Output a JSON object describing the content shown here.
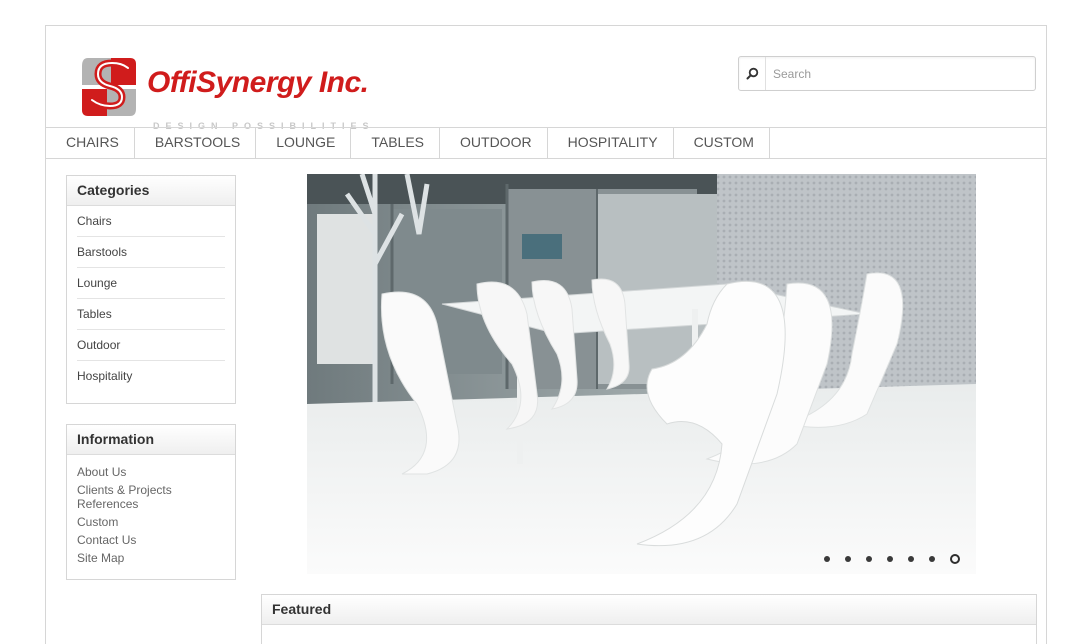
{
  "header": {
    "logo_name": "OffiSynergy Inc.",
    "logo_tagline": "DESIGN POSSIBILITIES"
  },
  "search": {
    "placeholder": "Search",
    "value": ""
  },
  "nav": {
    "items": [
      {
        "label": "CHAIRS"
      },
      {
        "label": "BARSTOOLS"
      },
      {
        "label": "LOUNGE"
      },
      {
        "label": "TABLES"
      },
      {
        "label": "OUTDOOR"
      },
      {
        "label": "HOSPITALITY"
      },
      {
        "label": "CUSTOM"
      }
    ]
  },
  "categories": {
    "title": "Categories",
    "items": [
      {
        "label": "Chairs"
      },
      {
        "label": "Barstools"
      },
      {
        "label": "Lounge"
      },
      {
        "label": "Tables"
      },
      {
        "label": "Outdoor"
      },
      {
        "label": "Hospitality"
      }
    ]
  },
  "information": {
    "title": "Information",
    "items": [
      {
        "label": "About Us"
      },
      {
        "label": "Clients & Projects",
        "sub": "References"
      },
      {
        "label": "Custom"
      },
      {
        "label": "Contact Us"
      },
      {
        "label": "Site Map"
      }
    ]
  },
  "slideshow": {
    "image": "white-chairs-dining-table-photo",
    "slide_count": 7,
    "active_slide": 7
  },
  "featured": {
    "title": "Featured"
  },
  "colors": {
    "brand_red": "#d01c1c",
    "logo_gray": "#b0b0b0",
    "border": "#d6d6d6"
  }
}
